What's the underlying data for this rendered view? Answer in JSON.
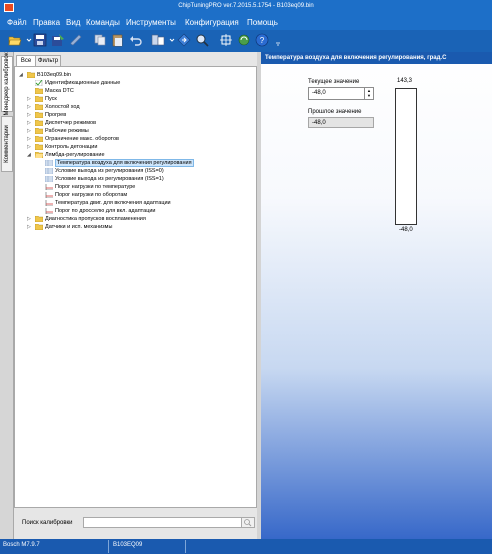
{
  "window": {
    "title": "ChipTuningPRO ver.7.2015.5.1754 - B103eq09.bin"
  },
  "menu": [
    "Файл",
    "Правка",
    "Вид",
    "Команды",
    "Инструменты",
    "Конфигурация",
    "Помощь"
  ],
  "toolbar": {
    "icons": [
      "open-icon",
      "save-icon",
      "save-as-icon",
      "edit-icon",
      "copy-icon",
      "paste-icon",
      "undo-icon",
      "compare-icon",
      "navigate-icon",
      "search-zoom-icon",
      "connect-icon",
      "refresh-icon",
      "help-icon"
    ]
  },
  "side_tabs": [
    "Менеджер калибровок",
    "Комментарии"
  ],
  "tabs": [
    "Все",
    "Фильтр"
  ],
  "tree": {
    "root": "B103eq09.bin",
    "items": [
      {
        "label": "Идентификационные данные",
        "icon": "id-icon"
      },
      {
        "label": "Маска DTC",
        "icon": "folder-icon"
      },
      {
        "label": "Пуск",
        "icon": "folder-icon"
      },
      {
        "label": "Холостой ход",
        "icon": "folder-icon"
      },
      {
        "label": "Прогрев",
        "icon": "folder-icon"
      },
      {
        "label": "Диспетчер режимов",
        "icon": "folder-icon"
      },
      {
        "label": "Рабочие режимы",
        "icon": "folder-icon"
      },
      {
        "label": "Ограничение макс. оборотов",
        "icon": "folder-icon"
      },
      {
        "label": "Контроль детонации",
        "icon": "folder-icon"
      },
      {
        "label": "Лямбда-регулирование",
        "icon": "folder-open-icon"
      },
      {
        "label": "Температура воздуха для включения регулирования",
        "icon": "table-icon"
      },
      {
        "label": "Условие выхода из регулирования (ISS=0)",
        "icon": "table-icon"
      },
      {
        "label": "Условие выхода из регулирования (ISS=1)",
        "icon": "table-icon"
      },
      {
        "label": "Порог нагрузки по температуре",
        "icon": "graph-icon"
      },
      {
        "label": "Порог нагрузки по оборотам",
        "icon": "graph-icon"
      },
      {
        "label": "Температура двиг. для включения адаптации",
        "icon": "graph-icon"
      },
      {
        "label": "Порог по дросселю для вкл. адаптации",
        "icon": "graph-icon"
      },
      {
        "label": "Диагностика пропусков воспламенения",
        "icon": "folder-icon"
      },
      {
        "label": "Датчики и исп. механизмы",
        "icon": "folder-icon"
      }
    ]
  },
  "search": {
    "label": "Поиск калибровки",
    "value": ""
  },
  "detail": {
    "header": "Температура воздуха для включения регулирования, град.С",
    "current_label": "Текущее значение",
    "current_value": "-48,0",
    "previous_label": "Прошлое значение",
    "previous_value": "-48,0",
    "gauge_max": "143,3",
    "gauge_min": "-48,0",
    "gauge_level": 0
  },
  "status": {
    "ecu": "Bosch M7.9.7",
    "file": "B103EQ09"
  },
  "colors": {
    "accent": "#1d6fc8",
    "selection": "#cde5fb",
    "folder": "#f0c64a"
  }
}
